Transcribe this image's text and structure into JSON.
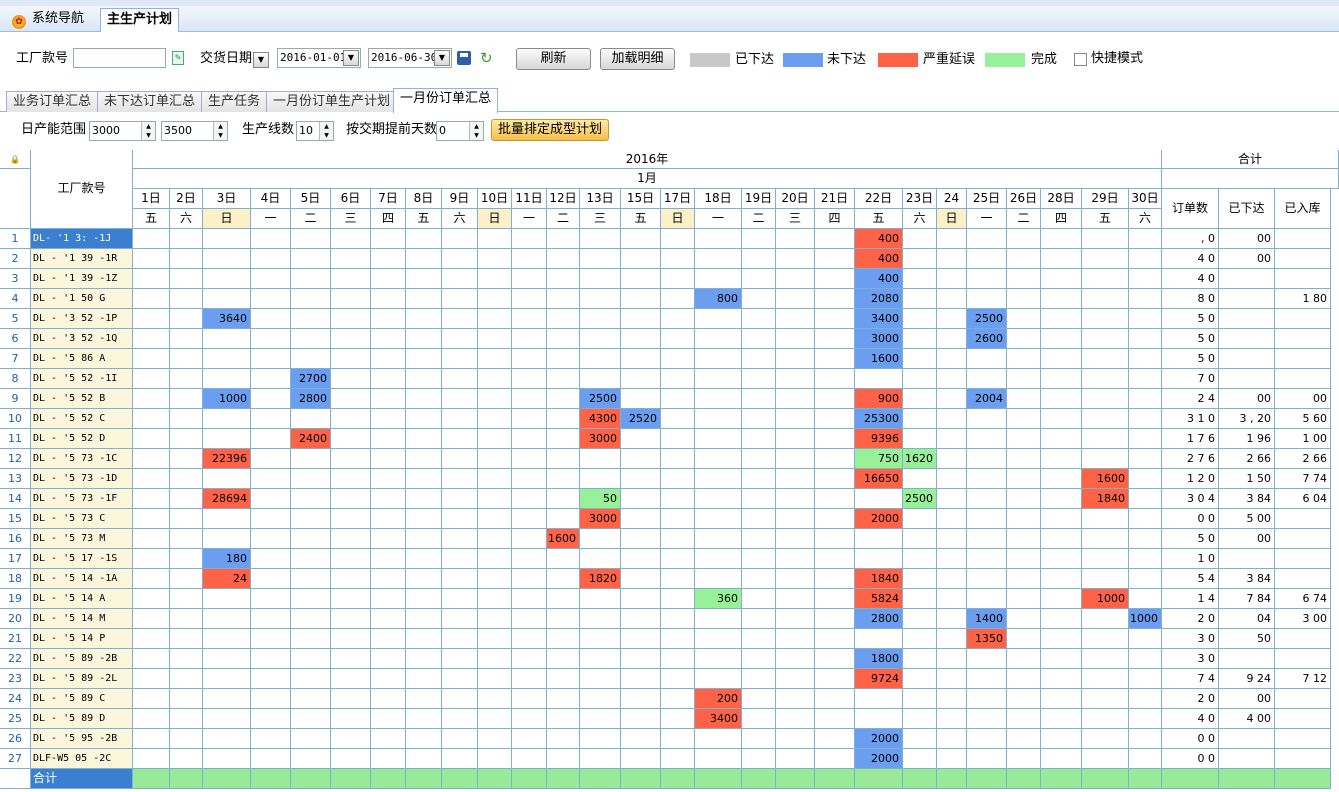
{
  "nav": {
    "tabs": [
      "系统导航",
      "主生产计划"
    ]
  },
  "toolbar": {
    "factory_label": "工厂款号",
    "factory_value": "",
    "date_label": "交货日期",
    "date_from": "2016-01-01",
    "date_to": "2016-06-30",
    "refresh": "刷新",
    "load_detail": "加载明细",
    "legend": [
      {
        "label": "已下达",
        "color": "#c8c8c8"
      },
      {
        "label": "未下达",
        "color": "#6b9ef0"
      },
      {
        "label": "严重延误",
        "color": "#ff6347"
      },
      {
        "label": "完成",
        "color": "#98f098"
      }
    ],
    "quick_mode": "快捷模式"
  },
  "tabs": [
    "业务订单汇总",
    "未下达订单汇总",
    "生产任务",
    "一月份订单生产计划",
    "一月份订单汇总"
  ],
  "toolbar2": {
    "capacity_label": "日产能范围",
    "capacity_min": "3000",
    "capacity_max": "3500",
    "lines_label": "生产线数",
    "lines": "10",
    "advance_label": "按交期提前天数",
    "advance": "0",
    "batch_button": "批量排定成型计划"
  },
  "grid": {
    "code_header": "工厂款号",
    "year": "2016年",
    "month": "1月",
    "total_header": "合计",
    "total_cols": [
      "订单数",
      "已下达",
      "已入库"
    ],
    "days": [
      "1日",
      "2日",
      "3日",
      "4日",
      "5日",
      "6日",
      "7日",
      "8日",
      "9日",
      "10日",
      "11日",
      "12日",
      "13日",
      "15日",
      "17日",
      "18日",
      "19日",
      "20日",
      "21日",
      "22日",
      "23日",
      "24",
      "25日",
      "26日",
      "28日",
      "29日",
      "30日"
    ],
    "weekdays": [
      "五",
      "六",
      "日",
      "一",
      "二",
      "三",
      "四",
      "五",
      "六",
      "日",
      "一",
      "二",
      "三",
      "五",
      "日",
      "一",
      "二",
      "三",
      "四",
      "五",
      "六",
      "日",
      "一",
      "二",
      "四",
      "五",
      "六"
    ],
    "rows": [
      {
        "n": "1",
        "code": "DL- '1 3: -1J",
        "c": {
          "22日": [
            "400",
            "r"
          ]
        },
        "t": [
          "  , 0",
          "  00",
          ""
        ]
      },
      {
        "n": "2",
        "code": "DL - '1 39 -1R",
        "c": {
          "22日": [
            "400",
            "r"
          ]
        },
        "t": [
          "4 0",
          "  00",
          ""
        ]
      },
      {
        "n": "3",
        "code": "DL - '1 39 -1Z",
        "c": {
          "22日": [
            "400",
            "b"
          ]
        },
        "t": [
          "4 0",
          "",
          ""
        ]
      },
      {
        "n": "4",
        "code": "DL - '1 50 G",
        "c": {
          "18日": [
            "800",
            "b"
          ],
          "22日": [
            "2080",
            "b"
          ]
        },
        "t": [
          "8 0",
          "",
          "1 80"
        ]
      },
      {
        "n": "5",
        "code": "DL - '3 52 -1P",
        "c": {
          "3日": [
            "3640",
            "b"
          ],
          "22日": [
            "3400",
            "b"
          ],
          "25日": [
            "2500",
            "b"
          ]
        },
        "t": [
          "5 0",
          "",
          ""
        ]
      },
      {
        "n": "6",
        "code": "DL - '3 52 -1Q",
        "c": {
          "22日": [
            "3000",
            "b"
          ],
          "25日": [
            "2600",
            "b"
          ]
        },
        "t": [
          "5 0",
          "",
          ""
        ]
      },
      {
        "n": "7",
        "code": "DL - '5 86 A",
        "c": {
          "22日": [
            "1600",
            "b"
          ]
        },
        "t": [
          "5 0",
          "",
          ""
        ]
      },
      {
        "n": "8",
        "code": "DL - '5 52 -1I",
        "c": {
          "5日": [
            "2700",
            "b"
          ]
        },
        "t": [
          "7 0",
          "",
          ""
        ]
      },
      {
        "n": "9",
        "code": "DL - '5 52 B",
        "c": {
          "3日": [
            "1000",
            "b"
          ],
          "5日": [
            "2800",
            "b"
          ],
          "13日": [
            "2500",
            "b"
          ],
          "22日": [
            "900",
            "r"
          ],
          "25日": [
            "2004",
            "b"
          ]
        },
        "t": [
          "2 4",
          "  00",
          "00"
        ]
      },
      {
        "n": "10",
        "code": "DL - '5 52 C",
        "c": {
          "13日": [
            "4300",
            "r"
          ],
          "15日": [
            "2520",
            "b"
          ],
          "22日": [
            "25300",
            "b"
          ]
        },
        "t": [
          "3 1 0",
          "3 , 20",
          "5 60"
        ]
      },
      {
        "n": "11",
        "code": "DL - '5 52 D",
        "c": {
          "5日": [
            "2400",
            "r"
          ],
          "13日": [
            "3000",
            "r"
          ],
          "22日": [
            "9396",
            "r"
          ]
        },
        "t": [
          "1 7 6",
          "1 96",
          "1 00"
        ]
      },
      {
        "n": "12",
        "code": "DL - '5 73 -1C",
        "c": {
          "3日": [
            "22396",
            "r"
          ],
          "22日": [
            "750",
            "g"
          ],
          "23日": [
            "1620",
            "g"
          ]
        },
        "t": [
          "2 7 6",
          "2 66",
          "2 66"
        ]
      },
      {
        "n": "13",
        "code": "DL - '5 73 -1D",
        "c": {
          "22日": [
            "16650",
            "r"
          ],
          "29日": [
            "1600",
            "r"
          ]
        },
        "t": [
          "1 2 0",
          "1 50",
          "7 74"
        ]
      },
      {
        "n": "14",
        "code": "DL - '5 73 -1F",
        "c": {
          "3日": [
            "28694",
            "r"
          ],
          "13日": [
            "50",
            "g"
          ],
          "23日": [
            "2500",
            "g"
          ],
          "29日": [
            "1840",
            "r"
          ]
        },
        "t": [
          "3 0 4",
          "3 84",
          "6 04"
        ]
      },
      {
        "n": "15",
        "code": "DL - '5 73 C",
        "c": {
          "13日": [
            "3000",
            "r"
          ],
          "22日": [
            "2000",
            "r"
          ]
        },
        "t": [
          "0 0",
          "5 00",
          ""
        ]
      },
      {
        "n": "16",
        "code": "DL - '5 73 M",
        "c": {
          "12日": [
            "1600",
            "r"
          ]
        },
        "t": [
          "5 0",
          "  00",
          ""
        ]
      },
      {
        "n": "17",
        "code": "DL - '5 17 -1S",
        "c": {
          "3日": [
            "180",
            "b"
          ]
        },
        "t": [
          "1 0",
          "",
          ""
        ]
      },
      {
        "n": "18",
        "code": "DL - '5 14 -1A",
        "c": {
          "3日": [
            "24",
            "r"
          ],
          "13日": [
            "1820",
            "r"
          ],
          "22日": [
            "1840",
            "r"
          ]
        },
        "t": [
          "5 4",
          "3 84",
          ""
        ]
      },
      {
        "n": "19",
        "code": "DL - '5 14 A",
        "c": {
          "18日": [
            "360",
            "g"
          ],
          "22日": [
            "5824",
            "r"
          ],
          "29日": [
            "1000",
            "r"
          ]
        },
        "t": [
          "1 4",
          "7 84",
          "6 74"
        ]
      },
      {
        "n": "20",
        "code": "DL - '5 14 M",
        "c": {
          "22日": [
            "2800",
            "b"
          ],
          "25日": [
            "1400",
            "b"
          ],
          "30日": [
            "1000",
            "b"
          ]
        },
        "t": [
          "2 0",
          "  04",
          "3 00"
        ]
      },
      {
        "n": "21",
        "code": "DL - '5 14 P",
        "c": {
          "25日": [
            "1350",
            "r"
          ]
        },
        "t": [
          "3 0",
          "  50",
          ""
        ]
      },
      {
        "n": "22",
        "code": "DL - '5 89 -2B",
        "c": {
          "22日": [
            "1800",
            "b"
          ]
        },
        "t": [
          "3 0",
          "",
          ""
        ]
      },
      {
        "n": "23",
        "code": "DL - '5 89 -2L",
        "c": {
          "22日": [
            "9724",
            "r"
          ]
        },
        "t": [
          "7 4",
          "9 24",
          "7 12"
        ]
      },
      {
        "n": "24",
        "code": "DL - '5 89 C",
        "c": {
          "18日": [
            "200",
            "r"
          ]
        },
        "t": [
          "2 0",
          "  00",
          ""
        ]
      },
      {
        "n": "25",
        "code": "DL - '5 89 D",
        "c": {
          "18日": [
            "3400",
            "r"
          ]
        },
        "t": [
          "4 0",
          "4 00",
          ""
        ]
      },
      {
        "n": "26",
        "code": "DL - '5 95 -2B",
        "c": {
          "22日": [
            "2000",
            "b"
          ]
        },
        "t": [
          "0 0",
          "",
          ""
        ]
      },
      {
        "n": "27",
        "code": "DLF-W5 05 -2C",
        "c": {
          "22日": [
            "2000",
            "b"
          ]
        },
        "t": [
          "0 0",
          "",
          ""
        ]
      }
    ],
    "total_label": "合计"
  }
}
